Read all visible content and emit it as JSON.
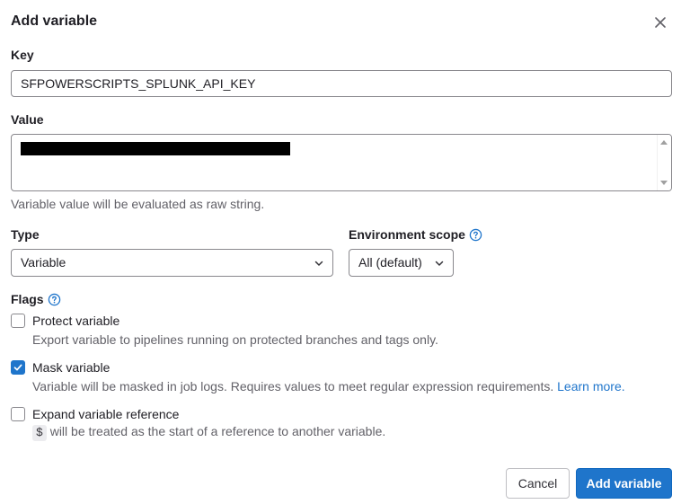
{
  "dialog": {
    "title": "Add variable"
  },
  "key": {
    "label": "Key",
    "value": "SFPOWERSCRIPTS_SPLUNK_API_KEY"
  },
  "value_field": {
    "label": "Value",
    "help": "Variable value will be evaluated as raw string."
  },
  "type": {
    "label": "Type",
    "selected": "Variable"
  },
  "environment_scope": {
    "label": "Environment scope",
    "selected": "All (default)"
  },
  "flags": {
    "label": "Flags",
    "protect": {
      "label": "Protect variable",
      "help": "Export variable to pipelines running on protected branches and tags only.",
      "checked": false
    },
    "mask": {
      "label": "Mask variable",
      "help": "Variable will be masked in job logs. Requires values to meet regular expression requirements.",
      "link": "Learn more.",
      "checked": true
    },
    "expand": {
      "label": "Expand variable reference",
      "code": "$",
      "help": "will be treated as the start of a reference to another variable.",
      "checked": false
    }
  },
  "actions": {
    "cancel": "Cancel",
    "submit": "Add variable"
  },
  "colors": {
    "primary": "#1f75cb",
    "border": "#89888d",
    "muted_text": "#626168"
  }
}
